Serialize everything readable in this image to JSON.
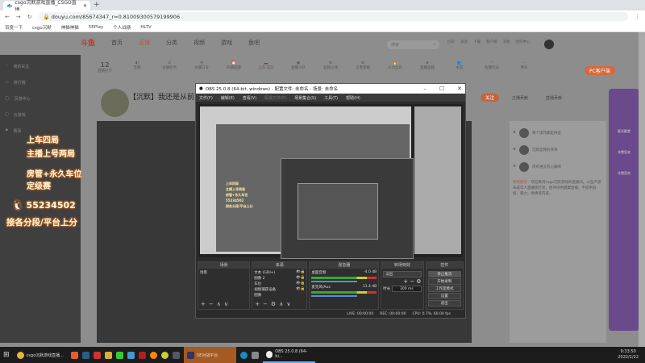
{
  "browser": {
    "tab_title": "csgo沉默游戏直播_CSGO直播",
    "url": "douyu.com/85674347_r=0.81009300579199906",
    "bookmarks": [
      "百度一下",
      "csgo沉默",
      "神猫神猫",
      "5EPlay",
      "个人战绩",
      "HLTV"
    ]
  },
  "site": {
    "logo": "斗鱼",
    "nav": [
      "首页",
      "直播",
      "分类",
      "视频",
      "游戏",
      "鱼吧"
    ],
    "search_placeholder": "搜索",
    "top_icons": [
      "历史",
      "关注",
      "下载",
      "客户端",
      "消息",
      "创作中心"
    ],
    "sidebar": [
      "我的关注",
      "排行榜",
      "页游中心",
      "云游戏",
      "赛事"
    ],
    "icon_row": [
      "12",
      "直播打卡",
      "音频",
      "主播任务",
      "主播口令",
      "开播提醒",
      "上车·车队",
      "直播小队",
      "穿越火线",
      "王者荣耀",
      "火力全开",
      "直播竞猜",
      "水友",
      "有趣玩法",
      "更多"
    ],
    "pc_button": "PC客户端",
    "stream_title": "【沉默】我还是从前那个少年",
    "follow": "关注",
    "rank_tabs": [
      "主播贡献",
      "直播贡献"
    ],
    "rank_users": [
      "每个操作都是奇迹",
      "沉默是我的爷爷",
      "尚有谁没有心痛啊"
    ],
    "notice_label": "系统提示：",
    "notice": "欢迎来到csgo沉默游戏的直播间。斗鱼严禁未成年人直播或打赏，倡导绿色健康直播，不提供低俗、暴力、色情等内容。",
    "promo": [
      "星光殿堂",
      "冰雪狂欢",
      "冰雪狂欢"
    ]
  },
  "overlay": {
    "line1": "上车四局",
    "line2": "主播上号两局",
    "line3": "房管+永久车位",
    "line4": "定级赛",
    "qq": "55234502",
    "line5": "接各分段/平台上分"
  },
  "obs": {
    "title": "OBS 25.0.8 (64-bit, windows) - 配置文件: 未命名 - 场景: 未命名",
    "menu": [
      "文件(F)",
      "编辑(E)",
      "查看(V)",
      "配置文件(P)",
      "场景集合(S)",
      "工具(T)",
      "帮助(H)"
    ],
    "docks": {
      "scenes": {
        "title": "场景",
        "items": [
          "场景"
        ]
      },
      "sources": {
        "title": "来源",
        "items": [
          "文本 (GDI+)",
          "图像 2",
          "车位",
          "视频捕获设备",
          "图像"
        ]
      },
      "mixer": {
        "title": "混音器",
        "channels": [
          {
            "name": "桌面音频",
            "db": "-4.0 dB"
          },
          {
            "name": "麦克风/Aux",
            "db": "11.4 dB"
          }
        ]
      },
      "transitions": {
        "title": "转场特效",
        "selected": "淡出",
        "duration_label": "时长",
        "duration": "300 ms"
      },
      "controls": {
        "title": "控件",
        "buttons": [
          "停止推流",
          "开始录制",
          "工作室模式",
          "设置",
          "退出"
        ]
      }
    },
    "status": {
      "live": "LIVE: 00:00:00",
      "rec": "REC: 00:00:00",
      "cpu": "CPU: 0.7%, 60.00 fps"
    }
  },
  "taskbar": {
    "items": [
      "csgo沉默游戏直播...",
      "5E对战平台",
      "OBS 25.0.8 (64-bi..."
    ],
    "time": "9:33:50",
    "date": "2022/1/22"
  }
}
